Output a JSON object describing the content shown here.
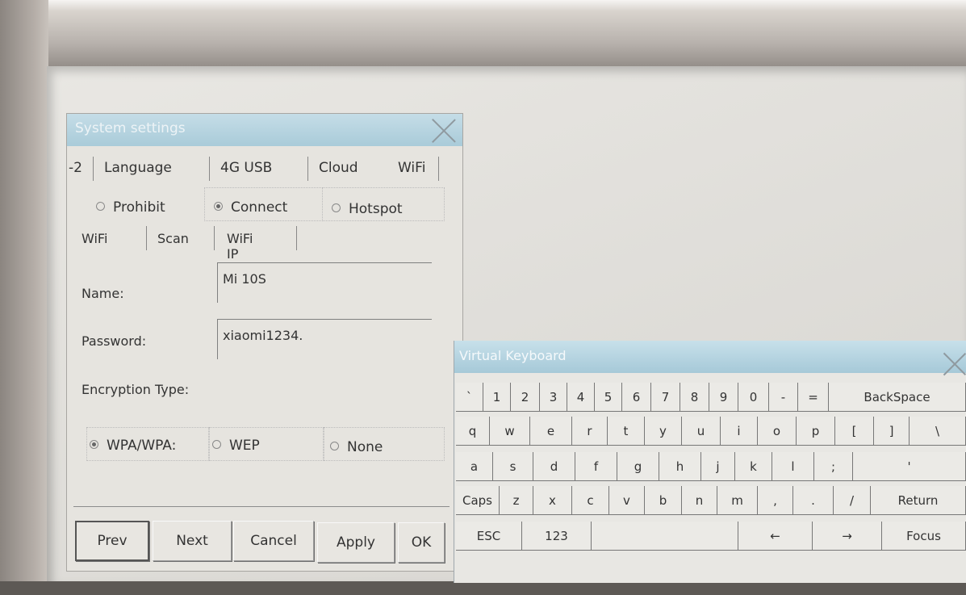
{
  "settings": {
    "title": "System settings",
    "tabs": [
      "-2",
      "Language",
      "4G USB",
      "Cloud",
      "WiFi"
    ],
    "mode_options": [
      {
        "label": "Prohibit",
        "selected": false
      },
      {
        "label": "Connect",
        "selected": true
      },
      {
        "label": "Hotspot",
        "selected": false
      }
    ],
    "subtabs": [
      "WiFi",
      "Scan",
      "WiFi IP"
    ],
    "name_label": "Name:",
    "name_value": "Mi 10S",
    "password_label": "Password:",
    "password_value": "xiaomi1234.",
    "encryption_label": "Encryption Type:",
    "encryption_options": [
      {
        "label": "WPA/WPA:",
        "selected": true
      },
      {
        "label": "WEP",
        "selected": false
      },
      {
        "label": "None",
        "selected": false
      }
    ],
    "buttons": {
      "prev": "Prev",
      "next": "Next",
      "cancel": "Cancel",
      "apply": "Apply",
      "ok": "OK"
    }
  },
  "keyboard": {
    "title": "Virtual Keyboard",
    "row1": [
      "`",
      "1",
      "2",
      "3",
      "4",
      "5",
      "6",
      "7",
      "8",
      "9",
      "0",
      "-",
      "=",
      "BackSpace"
    ],
    "row2": [
      "q",
      "w",
      "e",
      "r",
      "t",
      "y",
      "u",
      "i",
      "o",
      "p",
      "[",
      "]",
      "\\"
    ],
    "row3": [
      "a",
      "s",
      "d",
      "f",
      "g",
      "h",
      "j",
      "k",
      "l",
      ";",
      "'"
    ],
    "row4": [
      "Caps",
      "z",
      "x",
      "c",
      "v",
      "b",
      "n",
      "m",
      ",",
      ".",
      "/",
      "Return"
    ],
    "row5": [
      "ESC",
      "123",
      "",
      "←",
      "→",
      "Focus"
    ]
  }
}
